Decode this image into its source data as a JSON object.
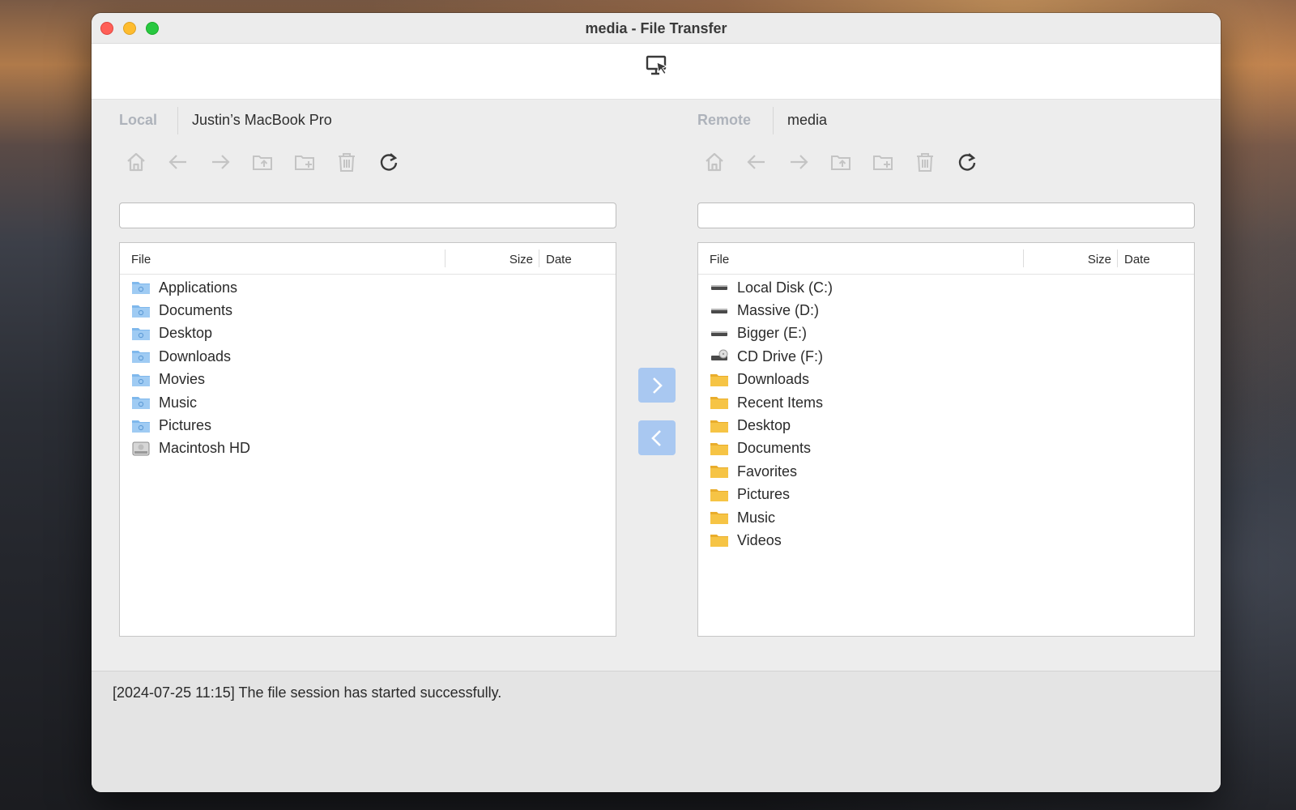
{
  "window": {
    "title": "media - File Transfer"
  },
  "local": {
    "kind": "Local",
    "host": "Justin’s MacBook Pro",
    "path_value": "",
    "columns": {
      "file": "File",
      "size": "Size",
      "date": "Date"
    },
    "items": [
      {
        "name": "Applications",
        "icon": "blue-folder-applications-icon"
      },
      {
        "name": "Documents",
        "icon": "blue-folder-documents-icon"
      },
      {
        "name": "Desktop",
        "icon": "blue-folder-desktop-icon"
      },
      {
        "name": "Downloads",
        "icon": "blue-folder-downloads-icon"
      },
      {
        "name": "Movies",
        "icon": "blue-folder-movies-icon"
      },
      {
        "name": "Music",
        "icon": "blue-folder-music-icon"
      },
      {
        "name": "Pictures",
        "icon": "blue-folder-pictures-icon"
      },
      {
        "name": "Macintosh HD",
        "icon": "hard-drive-icon"
      }
    ]
  },
  "remote": {
    "kind": "Remote",
    "host": "media",
    "path_value": "",
    "columns": {
      "file": "File",
      "size": "Size",
      "date": "Date"
    },
    "items": [
      {
        "name": "Local Disk (C:)",
        "icon": "disk-drive-icon"
      },
      {
        "name": "Massive (D:)",
        "icon": "disk-drive-icon"
      },
      {
        "name": "Bigger (E:)",
        "icon": "disk-drive-icon"
      },
      {
        "name": "CD Drive (F:)",
        "icon": "cd-drive-icon"
      },
      {
        "name": "Downloads",
        "icon": "yellow-folder-icon"
      },
      {
        "name": "Recent Items",
        "icon": "yellow-folder-icon"
      },
      {
        "name": "Desktop",
        "icon": "yellow-folder-icon"
      },
      {
        "name": "Documents",
        "icon": "yellow-folder-icon"
      },
      {
        "name": "Favorites",
        "icon": "yellow-folder-icon"
      },
      {
        "name": "Pictures",
        "icon": "yellow-folder-icon"
      },
      {
        "name": "Music",
        "icon": "yellow-folder-icon"
      },
      {
        "name": "Videos",
        "icon": "yellow-folder-icon"
      }
    ]
  },
  "toolbar_icons": [
    "home-icon",
    "back-arrow-icon",
    "forward-arrow-icon",
    "parent-folder-icon",
    "new-folder-icon",
    "trash-icon",
    "refresh-icon"
  ],
  "log": {
    "line": "[2024-07-25 11:15] The file session has started successfully."
  },
  "colors": {
    "accent": "#a9c8f1",
    "kind_label": "#aeb3bb",
    "blue_folder": "#7fb8ec",
    "yellow_folder": "#f6c445"
  }
}
